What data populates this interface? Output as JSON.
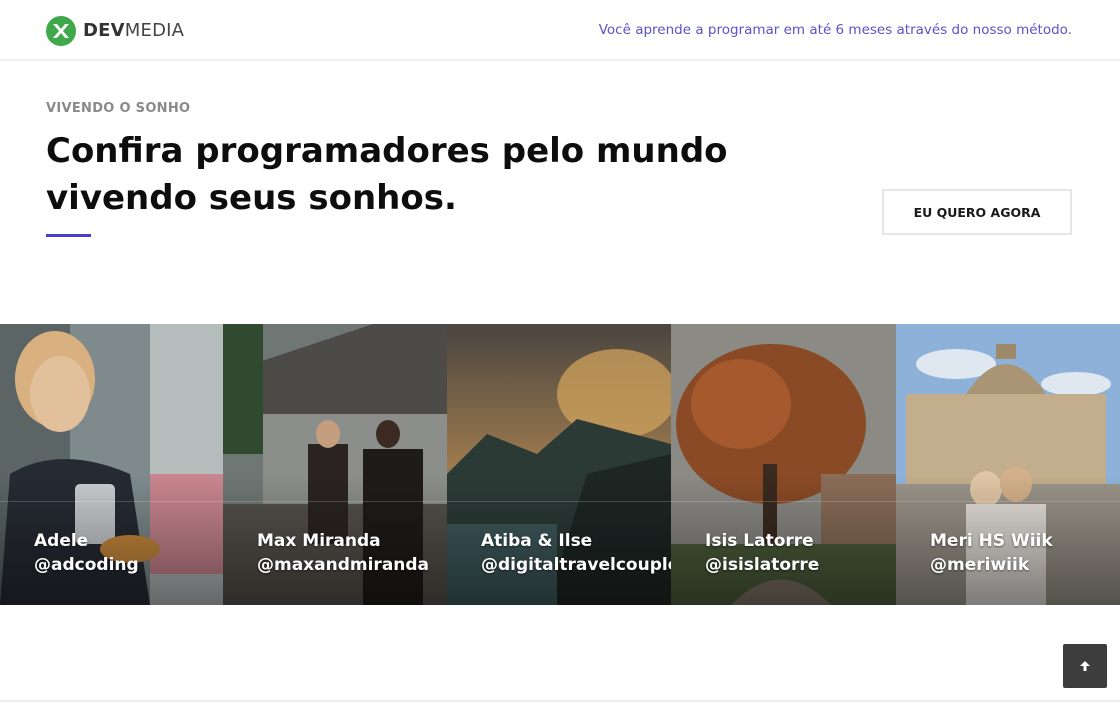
{
  "header": {
    "logo_dev": "DEV",
    "logo_media": "MEDIA",
    "tagline": "Você aprende a programar em até 6 meses através do nosso método."
  },
  "hero": {
    "eyebrow": "VIVENDO O SONHO",
    "headline_line1": "Confira programadores pelo mundo",
    "headline_line2": "vivendo seus sonhos.",
    "cta_label": "EU QUERO AGORA",
    "accent_color": "#4b3fd0"
  },
  "gallery": [
    {
      "name": "Adele",
      "handle": "@adcoding"
    },
    {
      "name": "Max Miranda",
      "handle": "@maxandmiranda"
    },
    {
      "name": "Atiba & Ilse",
      "handle": "@digitaltravelcouple"
    },
    {
      "name": "Isis Latorre",
      "handle": "@isislatorre"
    },
    {
      "name": "Meri HS Wiik",
      "handle": "@meriwiik"
    }
  ],
  "scroll_top": {
    "icon": "arrow-up-icon"
  },
  "colors": {
    "brand_green": "#3fa84a",
    "tagline_purple": "#5b53c9",
    "button_dark": "#3d3d3d"
  }
}
